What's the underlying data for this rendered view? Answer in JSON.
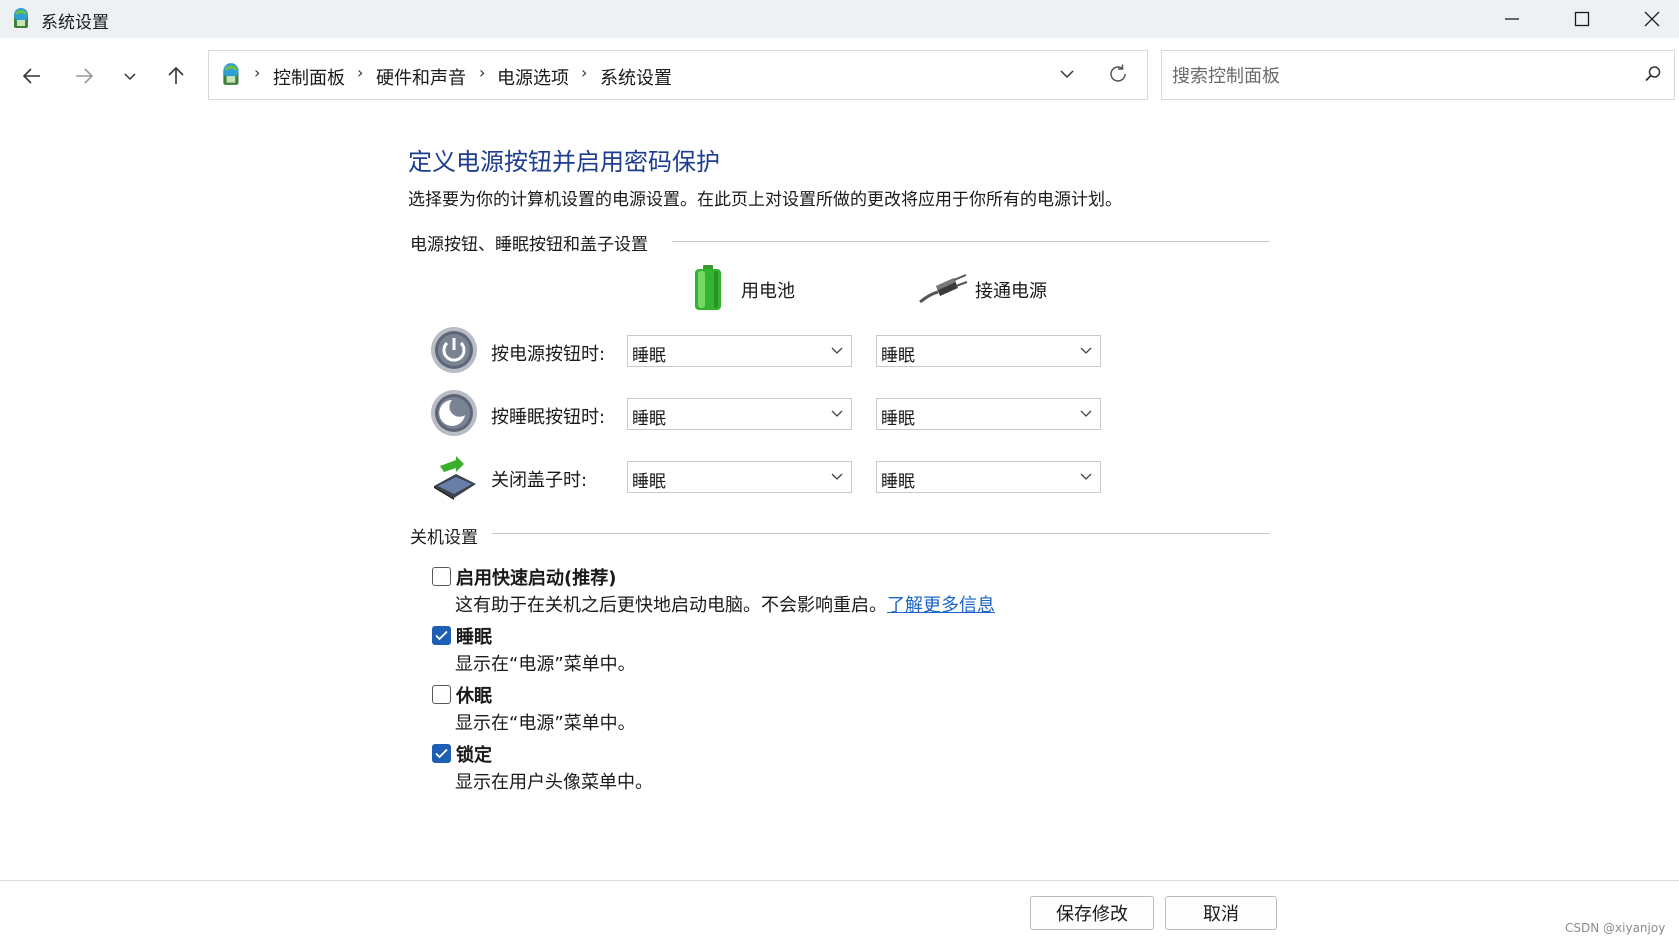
{
  "window": {
    "title": "系统设置"
  },
  "nav": {
    "breadcrumbs": [
      "控制面板",
      "硬件和声音",
      "电源选项",
      "系统设置"
    ],
    "search_placeholder": "搜索控制面板"
  },
  "page": {
    "heading": "定义电源按钮并启用密码保护",
    "description": "选择要为你的计算机设置的电源设置。在此页上对设置所做的更改将应用于你所有的电源计划。"
  },
  "buttons_section": {
    "label": "电源按钮、睡眠按钮和盖子设置",
    "columns": {
      "battery": "用电池",
      "plugged": "接通电源"
    },
    "rows": [
      {
        "label": "按电源按钮时:",
        "battery": "睡眠",
        "plugged": "睡眠",
        "icon": "power-button-icon"
      },
      {
        "label": "按睡眠按钮时:",
        "battery": "睡眠",
        "plugged": "睡眠",
        "icon": "sleep-button-icon"
      },
      {
        "label": "关闭盖子时:",
        "battery": "睡眠",
        "plugged": "睡眠",
        "icon": "laptop-lid-icon"
      }
    ]
  },
  "shutdown_section": {
    "label": "关机设置",
    "options": [
      {
        "title": "启用快速启动(推荐)",
        "desc": "这有助于在关机之后更快地启动电脑。不会影响重启。",
        "link": "了解更多信息",
        "checked": false
      },
      {
        "title": "睡眠",
        "desc": "显示在“电源”菜单中。",
        "checked": true
      },
      {
        "title": "休眠",
        "desc": "显示在“电源”菜单中。",
        "checked": false
      },
      {
        "title": "锁定",
        "desc": "显示在用户头像菜单中。",
        "checked": true
      }
    ]
  },
  "footer": {
    "save": "保存修改",
    "cancel": "取消"
  },
  "watermark": "CSDN @xiyanjoy",
  "colors": {
    "heading": "#1e3d8f",
    "checkbox_accent": "#1d5fb5",
    "link": "#1a64c8",
    "titlebar_bg": "#eef1f4"
  }
}
